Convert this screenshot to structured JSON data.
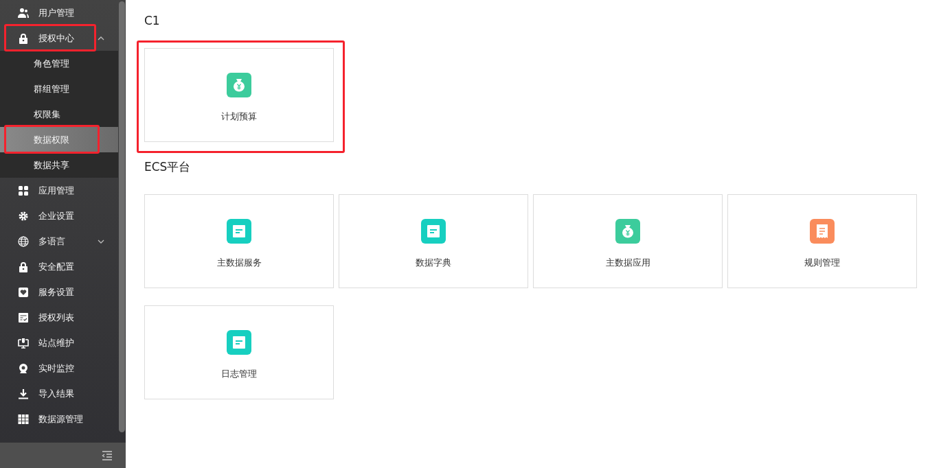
{
  "sidebar": {
    "items": [
      {
        "label": "用户管理",
        "kind": "users",
        "selected": false,
        "highlighted": false
      },
      {
        "label": "授权中心",
        "kind": "lock",
        "selected": false,
        "highlighted": true,
        "expanded": true,
        "children": [
          {
            "label": "角色管理",
            "selected": false,
            "highlighted": false
          },
          {
            "label": "群组管理",
            "selected": false,
            "highlighted": false
          },
          {
            "label": "权限集",
            "selected": false,
            "highlighted": false
          },
          {
            "label": "数据权限",
            "selected": true,
            "highlighted": true
          },
          {
            "label": "数据共享",
            "selected": false,
            "highlighted": false
          }
        ]
      },
      {
        "label": "应用管理",
        "kind": "grid",
        "selected": false,
        "highlighted": false
      },
      {
        "label": "企业设置",
        "kind": "gear",
        "selected": false,
        "highlighted": false
      },
      {
        "label": "多语言",
        "kind": "globe",
        "selected": false,
        "highlighted": false,
        "expanded": false
      },
      {
        "label": "安全配置",
        "kind": "lock",
        "selected": false,
        "highlighted": false
      },
      {
        "label": "服务设置",
        "kind": "heart",
        "selected": false,
        "highlighted": false
      },
      {
        "label": "授权列表",
        "kind": "checklist",
        "selected": false,
        "highlighted": false
      },
      {
        "label": "站点维护",
        "kind": "monitor",
        "selected": false,
        "highlighted": false
      },
      {
        "label": "实时监控",
        "kind": "webcam",
        "selected": false,
        "highlighted": false
      },
      {
        "label": "导入结果",
        "kind": "download",
        "selected": false,
        "highlighted": false
      },
      {
        "label": "数据源管理",
        "kind": "table",
        "selected": false,
        "highlighted": false
      }
    ]
  },
  "sections": [
    {
      "title": "C1",
      "cards": [
        {
          "label": "计划预算",
          "kind": "money",
          "color": "#3ccc9c",
          "highlighted": true
        }
      ]
    },
    {
      "title": "ECS平台",
      "cards": [
        {
          "label": "主数据服务",
          "kind": "doc",
          "color": "#17cfc0",
          "highlighted": false
        },
        {
          "label": "数据字典",
          "kind": "doc",
          "color": "#17cfc0",
          "highlighted": false
        },
        {
          "label": "主数据应用",
          "kind": "money",
          "color": "#3ccc9c",
          "highlighted": false
        },
        {
          "label": "规则管理",
          "kind": "receipt",
          "color": "#fa8c5c",
          "highlighted": false
        },
        {
          "label": "日志管理",
          "kind": "doc",
          "color": "#17cfc0",
          "highlighted": false
        }
      ]
    }
  ]
}
